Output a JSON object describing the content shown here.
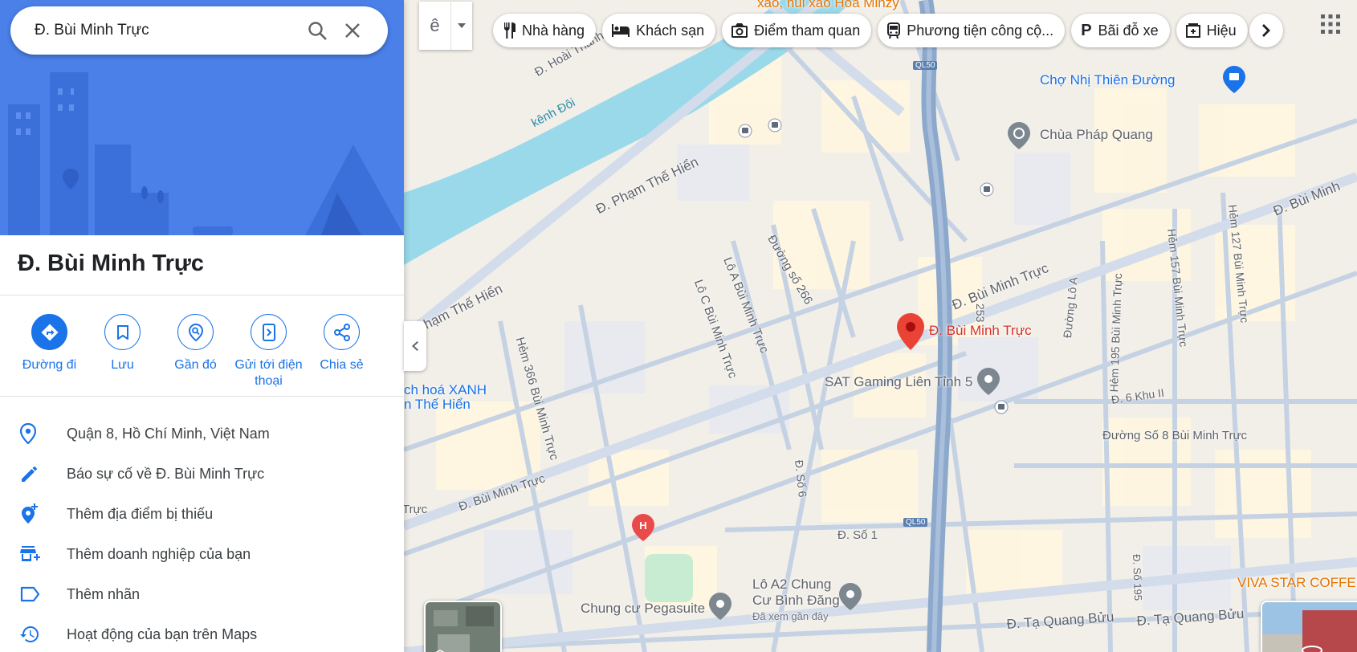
{
  "search": {
    "value": "Đ. Bùi Minh Trực"
  },
  "place": {
    "title": "Đ. Bùi Minh Trực"
  },
  "actions": [
    {
      "label": "Đường đi",
      "icon": "directions-icon"
    },
    {
      "label": "Lưu",
      "icon": "bookmark-icon"
    },
    {
      "label": "Gần đó",
      "icon": "nearby-icon"
    },
    {
      "label": "Gửi tới điện thoại",
      "icon": "send-to-phone-icon"
    },
    {
      "label": "Chia sẻ",
      "icon": "share-icon"
    }
  ],
  "info": [
    {
      "text": "Quận 8, Hồ Chí Minh, Việt Nam",
      "icon": "location-pin-icon"
    },
    {
      "text": "Báo sự cố về Đ. Bùi Minh Trực",
      "icon": "pencil-icon"
    },
    {
      "text": "Thêm địa điểm bị thiếu",
      "icon": "add-location-icon"
    },
    {
      "text": "Thêm doanh nghiệp của bạn",
      "icon": "add-business-icon"
    },
    {
      "text": "Thêm nhãn",
      "icon": "label-icon"
    },
    {
      "text": "Hoạt động của bạn trên Maps",
      "icon": "history-icon"
    }
  ],
  "toolbar": {
    "input_tool": "ê"
  },
  "chips": [
    {
      "label": "Nhà hàng",
      "icon": "restaurant-icon"
    },
    {
      "label": "Khách sạn",
      "icon": "hotel-icon"
    },
    {
      "label": "Điểm tham quan",
      "icon": "camera-icon"
    },
    {
      "label": "Phương tiện công cộ...",
      "icon": "transit-icon"
    },
    {
      "label": "Bãi đỗ xe",
      "icon": "parking-icon"
    },
    {
      "label": "Hiệu",
      "icon": "pharmacy-icon"
    }
  ],
  "map_labels": {
    "top_poi": "xáo, núi xáo Hòa Minzy",
    "hoai_thanh": "Đ. Hoài Thanh",
    "kenh_doi": "kênh Đôi",
    "pham_the_hien_1": "Đ. Phạm Thế Hiển",
    "pham_the_hien_2": "Đ. Phạm Thế Hiển",
    "cho_nhi_thien_duong": "Chợ Nhị Thiên Đường",
    "chua_phap_quang": "Chùa Pháp Quang",
    "ql50_top": "QL50",
    "ql50_bottom": "QL50",
    "duong_so_266": "Đường số 266",
    "lo_a": "Lô A Bùi Minh Trực",
    "lo_c": "Lô C Bùi Minh Trực",
    "hem_366": "Hẻm 366 Bùi Minh Trực",
    "bmt_main": "Đ. Bùi Minh Trực",
    "bmt_right": "Đ. Bùi Minh Trực",
    "bmt_far_right": "Đ. Bùi Minh",
    "bmt_lower": "Đ. Bùi Minh Trực",
    "bmt_left_edge": "Trực",
    "selected_place": "Đ. Bùi Minh Trực",
    "sat_gaming": "SAT Gaming Liên Tỉnh 5",
    "xanh_1": "ch hoá XANH",
    "xanh_2": "n Thế Hiển",
    "road_253": "253",
    "duong_lo_a": "Đường Lô A",
    "hem_195": "Hẻm 195 Bùi Minh Trực",
    "hem_157": "Hẻm 157 Bùi Minh Trực",
    "hem_127": "Hẻm 127 Bùi Minh Trực",
    "d6_khu": "Đ. 6 Khu II",
    "duong_so_8": "Đường Số 8 Bùi Minh Trực",
    "d_so_6": "Đ. Số 6",
    "d_so_1": "Đ. Số 1",
    "d_so_195": "Đ. Số 195",
    "lo_a2_1": "Lô A2 Chung",
    "lo_a2_2": "Cư Bình Đăng",
    "lo_a2_seen": "Đã xem gần đây",
    "pegasuite": "Chung cư Pegasuite",
    "ta_quang_buu_1": "Đ. Tạ Quang Bửu",
    "ta_quang_buu_2": "Đ. Tạ Quang Bửu",
    "viva_star": "VIVA STAR COFFE",
    "hospital": "H"
  },
  "colors": {
    "accent": "#1a73e8",
    "hero_bg": "#4a80e8",
    "water": "#9ad9ea",
    "highway": "#8ca9cc",
    "marker": "#ea4335"
  }
}
